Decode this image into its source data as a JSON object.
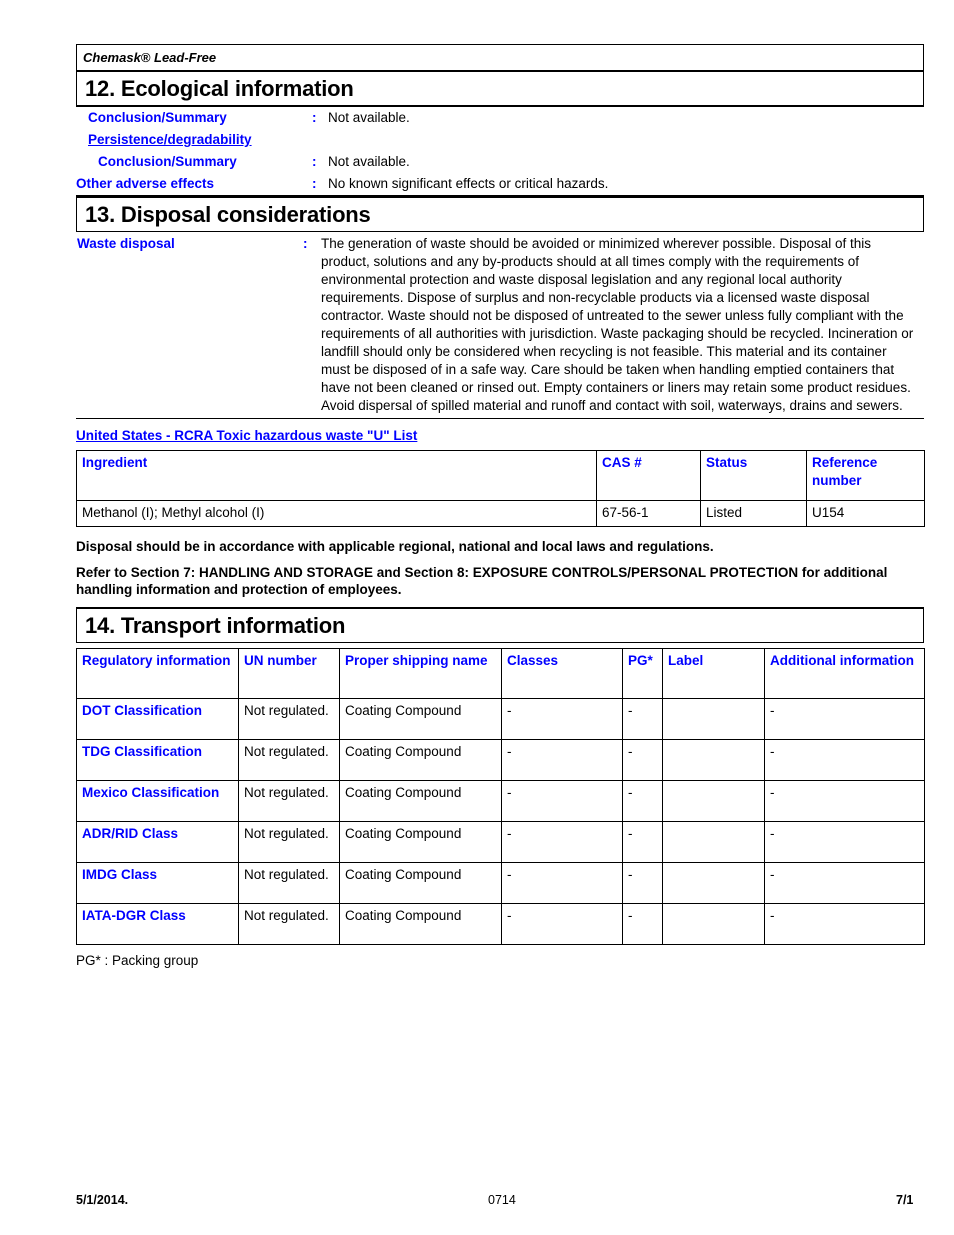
{
  "document": {
    "product_name": "Chemask® Lead-Free"
  },
  "section12": {
    "title": "12. Ecological information",
    "rows": [
      {
        "label": "Conclusion/Summary",
        "colon": ":",
        "value": "Not available.",
        "indent": 1,
        "underline": false
      },
      {
        "label": "Persistence/degradability",
        "colon": "",
        "value": "",
        "indent": 1,
        "underline": true
      },
      {
        "label": "Conclusion/Summary",
        "colon": ":",
        "value": "Not available.",
        "indent": 2,
        "underline": false
      },
      {
        "label": "Other adverse effects",
        "colon": ":",
        "value": "No known significant effects or critical hazards.",
        "indent": 0,
        "underline": false
      }
    ]
  },
  "section13": {
    "title": "13. Disposal considerations",
    "waste_disposal_label": "Waste disposal",
    "colon": ":",
    "waste_disposal_text": "The generation of waste should be avoided or minimized wherever possible.  Disposal of this product, solutions and any by-products should at all times comply with the requirements of environmental protection and waste disposal legislation and any regional local authority requirements.  Dispose of surplus and non-recyclable products via a licensed waste disposal contractor.  Waste should not be disposed of untreated to the sewer unless fully compliant with the requirements of all authorities with jurisdiction.  Waste packaging should be recycled.  Incineration or landfill should only be considered when recycling is not feasible.  This material and its container must be disposed of in a safe way.  Care should be taken when handling emptied containers that have not been cleaned or rinsed out.  Empty containers or liners may retain some product residues.  Avoid dispersal of spilled material and runoff and contact with soil, waterways, drains and sewers.",
    "rcra_heading": "United States - RCRA Toxic hazardous waste \"U\" List",
    "rcra_table": {
      "headers": [
        "Ingredient",
        "CAS #",
        "Status",
        "Reference number"
      ],
      "rows": [
        [
          "Methanol (I); Methyl alcohol (I)",
          "67-56-1",
          "Listed",
          "U154"
        ]
      ]
    },
    "note1": "Disposal should be in accordance with applicable regional, national and local laws and regulations.",
    "note2": "Refer to Section 7: HANDLING AND STORAGE and Section 8: EXPOSURE CONTROLS/PERSONAL PROTECTION for additional handling information and protection of employees."
  },
  "section14": {
    "title": "14. Transport information",
    "table": {
      "headers": [
        "Regulatory information",
        "UN number",
        "Proper shipping name",
        "Classes",
        "PG*",
        "Label",
        "Additional information"
      ],
      "rows": [
        [
          "DOT Classification",
          "Not regulated.",
          "Coating Compound",
          "-",
          "-",
          "",
          "-"
        ],
        [
          "TDG Classification",
          "Not regulated.",
          "Coating Compound",
          "-",
          "-",
          "",
          "-"
        ],
        [
          "Mexico Classification",
          "Not regulated.",
          "Coating Compound",
          "-",
          "-",
          "",
          "-"
        ],
        [
          "ADR/RID Class",
          "Not regulated.",
          "Coating Compound",
          "-",
          "-",
          "",
          "-"
        ],
        [
          "IMDG Class",
          "Not regulated.",
          "Coating Compound",
          "-",
          "-",
          "",
          "-"
        ],
        [
          "IATA-DGR Class",
          "Not regulated.",
          "Coating Compound",
          "-",
          "-",
          "",
          "-"
        ]
      ]
    },
    "pg_note": "PG* : Packing group"
  },
  "footer": {
    "date": "5/1/2014.",
    "code": "0714",
    "page": "7/1"
  },
  "colors": {
    "heading_blue": "#0000FF",
    "text_black": "#000000",
    "background": "#FFFFFF"
  }
}
